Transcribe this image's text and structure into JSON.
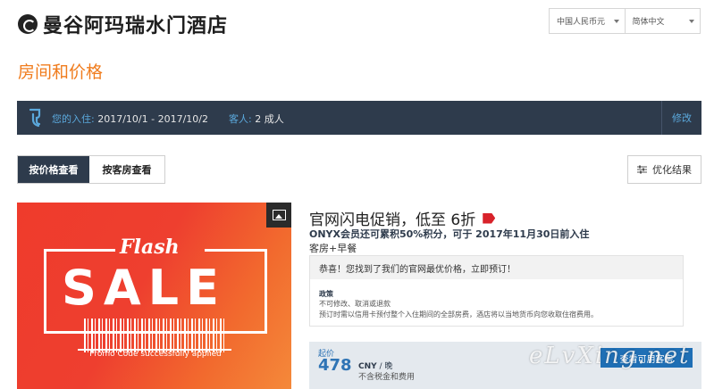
{
  "header": {
    "hotel_name": "曼谷阿玛瑞水门酒店",
    "currency": "中国人民币元",
    "language": "简体中文"
  },
  "section_title": "房间和价格",
  "stay": {
    "dates_label": "您的入住:",
    "dates_value": " 2017/10/1 - 2017/10/2",
    "guests_label": "客人:",
    "guests_value": " 2 成人",
    "edit_label": "修改"
  },
  "view_tabs": {
    "by_price": "按价格查看",
    "by_room": "按客房查看"
  },
  "refine_label": "优化结果",
  "promo_image": {
    "flash": "Flash",
    "sale": "SALE",
    "promo_code": "Promo Code successfully applied",
    "icon": "image-icon"
  },
  "offer": {
    "title": "官网闪电促销，低至 6折",
    "subtitle": "ONYX会员还可累积50%积分，可于 2017年11月30日前入住",
    "room_type": "客房+早餐",
    "info_message": "恭喜！您找到了我们的官网最优价格，立即预订！",
    "policy_label": "政策",
    "policy_line1": "不可修改、取消或退款",
    "policy_line2": "预订时需以信用卡预付整个入住期间的全部房费，酒店将以当地货币向您收取住宿费用。"
  },
  "price": {
    "from_label": "起价",
    "amount": "478",
    "currency": "CNY",
    "per_night": " / 晚",
    "note": "不含税金和费用",
    "book_label": "查看可用客房"
  },
  "watermark": "eLvXing.net",
  "colors": {
    "accent_orange": "#f07c1d",
    "dark_navy": "#2e3b4c",
    "link_blue": "#5ba9dd",
    "price_blue": "#2f74b5",
    "promo_red": "#ef3b2c"
  }
}
